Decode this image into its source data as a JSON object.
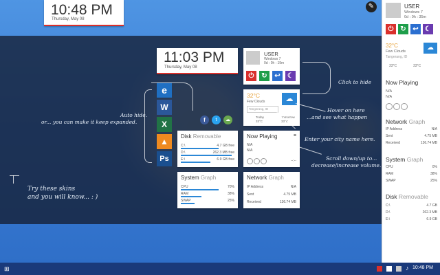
{
  "top_clock": {
    "time": "10:48 PM",
    "date": "Thursday, May 08"
  },
  "top_user": {
    "name": "USER",
    "os": "Windows 7",
    "uptime": "0d : 0h : 35m"
  },
  "skin": {
    "clock": {
      "time": "11:03 PM",
      "date": "Thursday, May 08"
    },
    "user": {
      "name": "USER",
      "os": "Windows 7",
      "uptime": "0d : 0h : 19m"
    },
    "weather": {
      "temp": "32°C",
      "cond": "Few Clouds",
      "city_placeholder": "Tangerang, ID",
      "today_label": "Today",
      "today_temp": "33°C",
      "tomorrow_label": "Tomorrow",
      "tomorrow_temp": "33°C"
    },
    "disk": {
      "title": "Disk",
      "subtitle": "Removable",
      "drives": [
        {
          "name": "C:\\",
          "free": "4.7 GB free",
          "fill": 0.7
        },
        {
          "name": "D:\\",
          "free": "262.3 MB free",
          "fill": 0.95
        },
        {
          "name": "E:\\",
          "free": "6.9 GB free",
          "fill": 0.55
        }
      ]
    },
    "now_playing": {
      "title": "Now Playing",
      "artist": "N/A",
      "track": "N/A",
      "time": "--:--"
    },
    "system": {
      "title": "System",
      "subtitle": "Graph",
      "rows": [
        {
          "label": "CPU",
          "value": "70%",
          "fill": 0.7
        },
        {
          "label": "RAM",
          "value": "38%",
          "fill": 0.38
        },
        {
          "label": "SWAP",
          "value": "25%",
          "fill": 0.25
        }
      ]
    },
    "network": {
      "title": "Network",
      "subtitle": "Graph",
      "rows": [
        {
          "label": "IP Address",
          "value": "N/A"
        },
        {
          "label": "Sent",
          "value": "4.75 MB"
        },
        {
          "label": "Received",
          "value": "136.74 MB"
        }
      ]
    }
  },
  "annotations": {
    "auto_hide": "Auto hide.",
    "keep_expanded": "or... you can make it keep expanded.",
    "click_hide": "Click to hide",
    "hover": "Hover on here",
    "hover2": "...and see what happen",
    "city": "Enter your city name here.",
    "scroll": "Scroll down/up to...",
    "scroll2": "decrease/increase volume.",
    "try1": "Try these skins",
    "try2": "and you will know...   : )"
  },
  "sidebar": {
    "user": {
      "name": "USER",
      "os": "Windows 7",
      "uptime": "0d : 0h : 35m"
    },
    "weather": {
      "temp": "32°C",
      "cond": "Few Clouds",
      "city": "Tangerang, ID",
      "today": "33°C",
      "tomorrow": "33°C"
    },
    "now_playing": {
      "title": "Now Playing",
      "artist": "N/A",
      "track": "N/A"
    },
    "network": {
      "title": "Network",
      "subtitle": "Graph",
      "rows": [
        {
          "label": "IP Address",
          "value": "N/A"
        },
        {
          "label": "Sent",
          "value": "4.75 MB"
        },
        {
          "label": "Received",
          "value": "136.74 MB"
        }
      ]
    },
    "system": {
      "title": "System",
      "subtitle": "Graph",
      "rows": [
        {
          "label": "CPU",
          "value": "0%"
        },
        {
          "label": "RAM",
          "value": "38%"
        },
        {
          "label": "SWAP",
          "value": "25%"
        }
      ]
    },
    "disk": {
      "title": "Disk",
      "subtitle": "Removable",
      "rows": [
        {
          "label": "C:\\",
          "value": "4.7 GB"
        },
        {
          "label": "D:\\",
          "value": "262.3 MB"
        },
        {
          "label": "E:\\",
          "value": "6.9 GB"
        }
      ]
    }
  },
  "taskbar": {
    "clock": "10:48 PM"
  },
  "colors": {
    "red": "#d9302c",
    "green": "#1e9e4a",
    "blue": "#2b6fd0",
    "purple": "#6a3bb0"
  }
}
